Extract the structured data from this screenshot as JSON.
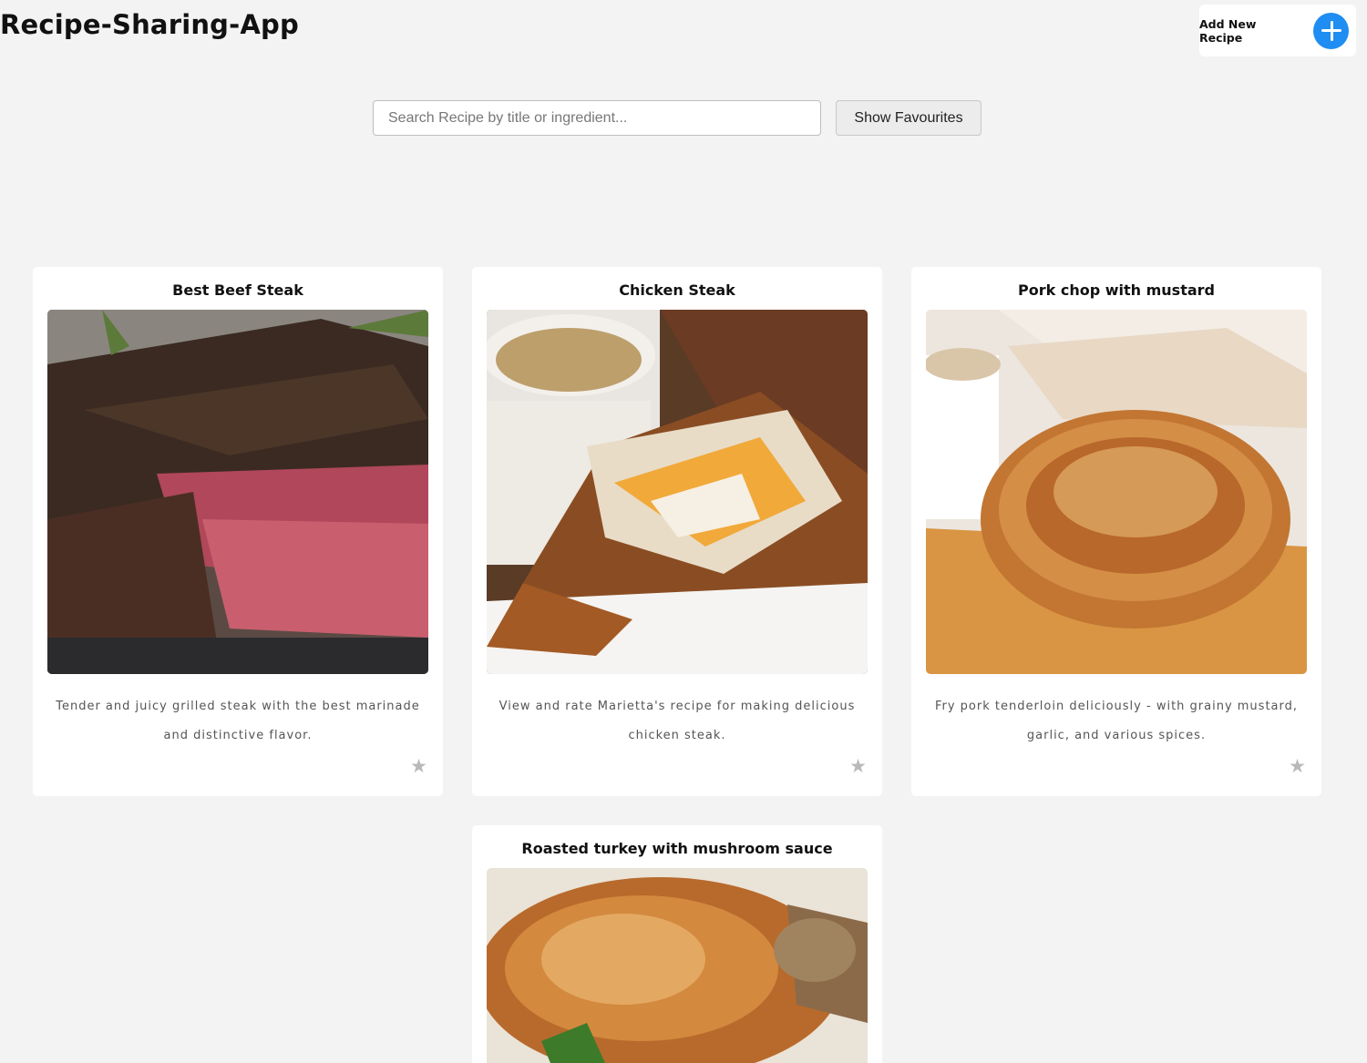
{
  "header": {
    "title": "Recipe-Sharing-App",
    "add_button_label": "Add New Recipe"
  },
  "search": {
    "placeholder": "Search Recipe by title or ingredient...",
    "value": "",
    "favourites_label": "Show Favourites"
  },
  "recipes": [
    {
      "title": "Best Beef Steak",
      "description": "Tender and juicy grilled steak with the best marinade and distinctive flavor.",
      "favourite_icon": "star-icon",
      "image": "grilled beef steak photo"
    },
    {
      "title": "Chicken Steak",
      "description": "View and rate Marietta's recipe for making delicious chicken steak.",
      "favourite_icon": "star-icon",
      "image": "chicken steak with cheese photo"
    },
    {
      "title": "Pork chop with mustard",
      "description": "Fry pork tenderloin deliciously - with grainy mustard, garlic, and various spices.",
      "favourite_icon": "star-icon",
      "image": "pork tenderloin with mustard photo"
    },
    {
      "title": "Roasted turkey with mushroom sauce",
      "description": "",
      "favourite_icon": "star-icon",
      "image": "roasted turkey photo"
    }
  ],
  "colors": {
    "background": "#f3f3f3",
    "accent": "#1f8df1",
    "star_inactive": "#b9b9b9"
  }
}
